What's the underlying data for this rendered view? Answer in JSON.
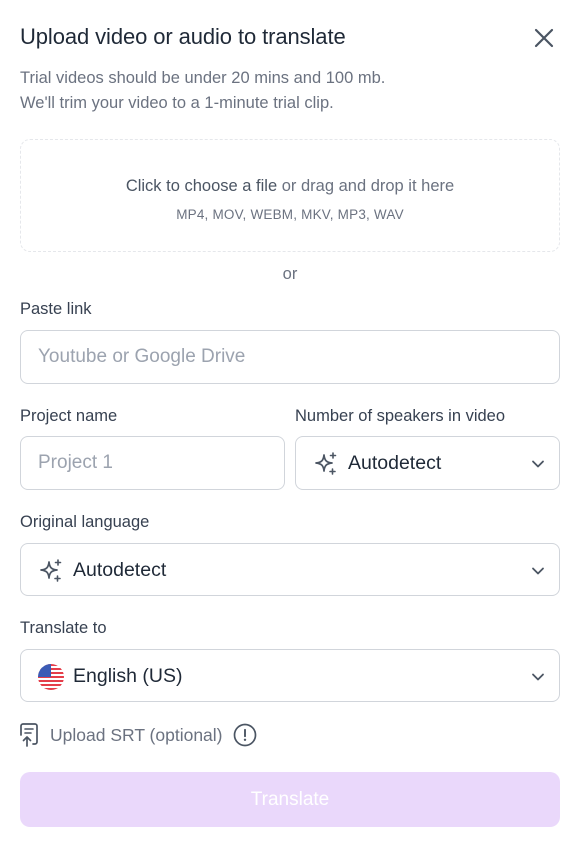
{
  "dialog": {
    "title": "Upload video or audio to translate",
    "subtitle_line1": "Trial videos should be under 20 mins and 100 mb.",
    "subtitle_line2": "We'll trim your video to a 1-minute trial clip."
  },
  "dropzone": {
    "choose_label": "Click to choose a file",
    "drag_label": " or drag and drop it here",
    "formats": "MP4, MOV, WEBM, MKV, MP3, WAV"
  },
  "divider_or": "or",
  "paste_link": {
    "label": "Paste link",
    "placeholder": "Youtube or Google Drive",
    "value": ""
  },
  "project_name": {
    "label": "Project name",
    "placeholder": "Project 1",
    "value": ""
  },
  "speakers": {
    "label": "Number of speakers in video",
    "value": "Autodetect",
    "icon": "sparkles-icon"
  },
  "original_language": {
    "label": "Original language",
    "value": "Autodetect",
    "icon": "sparkles-icon"
  },
  "translate_to": {
    "label": "Translate to",
    "value": "English (US)",
    "icon": "us-flag-icon"
  },
  "srt": {
    "label": "Upload SRT (optional)",
    "icon": "file-upload-icon",
    "info_icon": "info-icon"
  },
  "translate_button": {
    "label": "Translate",
    "disabled": true
  },
  "colors": {
    "primary_disabled": "#ead8fb",
    "text_muted": "#6b7280",
    "border": "#d1d5db"
  }
}
